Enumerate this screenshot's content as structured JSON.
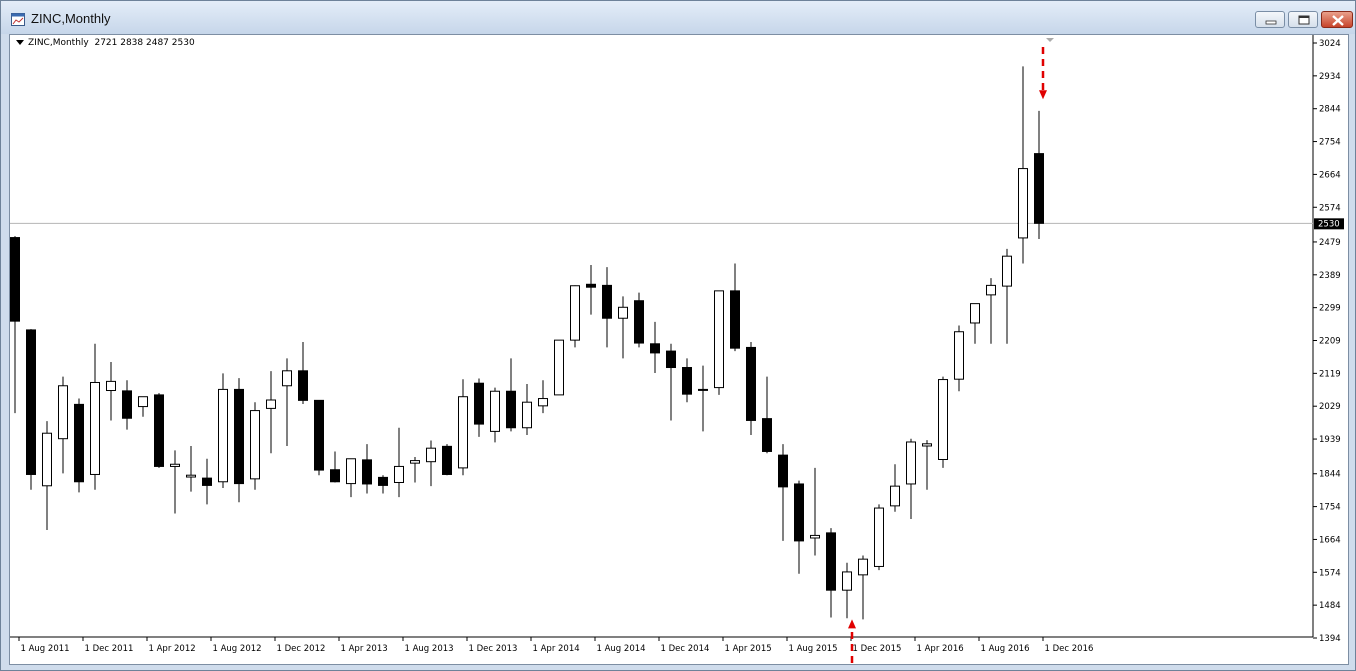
{
  "window": {
    "title": "ZINC,Monthly"
  },
  "chart_header": {
    "symbol": "ZINC,Monthly",
    "ohlc": "2721 2838 2487 2530"
  },
  "icons": {
    "app": "chart-window-icon",
    "minimize": "minimize-icon",
    "restore": "restore-icon",
    "close": "close-icon",
    "header_menu": "triangle-down-icon"
  },
  "colors": {
    "bull_fill": "#ffffff",
    "bear_fill": "#000000",
    "wick": "#000000",
    "price_line": "#b4b4b4",
    "arrow": "#e00000",
    "current_price_bg": "#000000"
  },
  "chart_data": {
    "type": "candlestick",
    "title": "ZINC,Monthly",
    "price_axis_ticks": [
      3024,
      2934,
      2844,
      2754,
      2664,
      2574,
      2479,
      2389,
      2299,
      2209,
      2119,
      2029,
      1939,
      1844,
      1754,
      1664,
      1574,
      1484,
      1394
    ],
    "time_axis_labels": [
      "1 Aug 2011",
      "1 Dec 2011",
      "1 Apr 2012",
      "1 Aug 2012",
      "1 Dec 2012",
      "1 Apr 2013",
      "1 Aug 2013",
      "1 Dec 2013",
      "1 Apr 2014",
      "1 Aug 2014",
      "1 Dec 2014",
      "1 Apr 2015",
      "1 Aug 2015",
      "1 Dec 2015",
      "1 Apr 2016",
      "1 Aug 2016",
      "1 Dec 2016"
    ],
    "current_price": "2530",
    "ylim": [
      1394,
      3024
    ],
    "annotations": [
      {
        "type": "arrow-down",
        "at": "1 Dec 2016",
        "value": 2870
      },
      {
        "type": "arrow-up",
        "at": "1 Dec 2015",
        "value": 1445
      }
    ],
    "candles": [
      {
        "d": "Jul 2011",
        "o": 2491,
        "h": 2495,
        "l": 2010,
        "c": 2262
      },
      {
        "d": "Aug 2011",
        "o": 2238,
        "h": 2240,
        "l": 1800,
        "c": 1842
      },
      {
        "d": "Sep 2011",
        "o": 1811,
        "h": 1988,
        "l": 1690,
        "c": 1955
      },
      {
        "d": "Oct 2011",
        "o": 1940,
        "h": 2110,
        "l": 1845,
        "c": 2085
      },
      {
        "d": "Nov 2011",
        "o": 2034,
        "h": 2050,
        "l": 1793,
        "c": 1822
      },
      {
        "d": "Dec 2011",
        "o": 1842,
        "h": 2200,
        "l": 1800,
        "c": 2094
      },
      {
        "d": "Jan 2012",
        "o": 2072,
        "h": 2150,
        "l": 1990,
        "c": 2097
      },
      {
        "d": "Feb 2012",
        "o": 2071,
        "h": 2100,
        "l": 1965,
        "c": 1996
      },
      {
        "d": "Mar 2012",
        "o": 2028,
        "h": 2055,
        "l": 2000,
        "c": 2055
      },
      {
        "d": "Apr 2012",
        "o": 2060,
        "h": 2065,
        "l": 1860,
        "c": 1864
      },
      {
        "d": "May 2012",
        "o": 1864,
        "h": 1908,
        "l": 1735,
        "c": 1870
      },
      {
        "d": "Jun 2012",
        "o": 1835,
        "h": 1920,
        "l": 1795,
        "c": 1840
      },
      {
        "d": "Jul 2012",
        "o": 1832,
        "h": 1885,
        "l": 1760,
        "c": 1812
      },
      {
        "d": "Aug 2012",
        "o": 1822,
        "h": 2119,
        "l": 1805,
        "c": 2075
      },
      {
        "d": "Sep 2012",
        "o": 2075,
        "h": 2106,
        "l": 1766,
        "c": 1817
      },
      {
        "d": "Oct 2012",
        "o": 1830,
        "h": 2040,
        "l": 1800,
        "c": 2017
      },
      {
        "d": "Nov 2012",
        "o": 2023,
        "h": 2125,
        "l": 1900,
        "c": 2046
      },
      {
        "d": "Dec 2012",
        "o": 2085,
        "h": 2160,
        "l": 1920,
        "c": 2126
      },
      {
        "d": "Jan 2013",
        "o": 2126,
        "h": 2205,
        "l": 2035,
        "c": 2045
      },
      {
        "d": "Feb 2013",
        "o": 2045,
        "h": 2045,
        "l": 1840,
        "c": 1854
      },
      {
        "d": "Mar 2013",
        "o": 1855,
        "h": 1905,
        "l": 1820,
        "c": 1822
      },
      {
        "d": "Apr 2013",
        "o": 1817,
        "h": 1880,
        "l": 1780,
        "c": 1885
      },
      {
        "d": "May 2013",
        "o": 1882,
        "h": 1925,
        "l": 1790,
        "c": 1816
      },
      {
        "d": "Jun 2013",
        "o": 1834,
        "h": 1840,
        "l": 1790,
        "c": 1812
      },
      {
        "d": "Jul 2013",
        "o": 1820,
        "h": 1970,
        "l": 1780,
        "c": 1864
      },
      {
        "d": "Aug 2013",
        "o": 1873,
        "h": 1890,
        "l": 1820,
        "c": 1880
      },
      {
        "d": "Sep 2013",
        "o": 1877,
        "h": 1935,
        "l": 1810,
        "c": 1914
      },
      {
        "d": "Oct 2013",
        "o": 1919,
        "h": 1925,
        "l": 1840,
        "c": 1842
      },
      {
        "d": "Nov 2013",
        "o": 1860,
        "h": 2103,
        "l": 1840,
        "c": 2055
      },
      {
        "d": "Dec 2013",
        "o": 2092,
        "h": 2105,
        "l": 1945,
        "c": 1980
      },
      {
        "d": "Jan 2014",
        "o": 1960,
        "h": 2080,
        "l": 1930,
        "c": 2070
      },
      {
        "d": "Feb 2014",
        "o": 2070,
        "h": 2160,
        "l": 1960,
        "c": 1970
      },
      {
        "d": "Mar 2014",
        "o": 1970,
        "h": 2090,
        "l": 1950,
        "c": 2040
      },
      {
        "d": "Apr 2014",
        "o": 2030,
        "h": 2100,
        "l": 2010,
        "c": 2050
      },
      {
        "d": "May 2014",
        "o": 2060,
        "h": 2210,
        "l": 2060,
        "c": 2210
      },
      {
        "d": "Jun 2014",
        "o": 2210,
        "h": 2360,
        "l": 2190,
        "c": 2359
      },
      {
        "d": "Jul 2014",
        "o": 2363,
        "h": 2416,
        "l": 2280,
        "c": 2355
      },
      {
        "d": "Aug 2014",
        "o": 2360,
        "h": 2410,
        "l": 2190,
        "c": 2270
      },
      {
        "d": "Sep 2014",
        "o": 2270,
        "h": 2330,
        "l": 2160,
        "c": 2300
      },
      {
        "d": "Oct 2014",
        "o": 2318,
        "h": 2340,
        "l": 2190,
        "c": 2202
      },
      {
        "d": "Nov 2014",
        "o": 2200,
        "h": 2260,
        "l": 2120,
        "c": 2175
      },
      {
        "d": "Dec 2014",
        "o": 2180,
        "h": 2200,
        "l": 1990,
        "c": 2135
      },
      {
        "d": "Jan 2015",
        "o": 2135,
        "h": 2160,
        "l": 2040,
        "c": 2062
      },
      {
        "d": "Feb 2015",
        "o": 2075,
        "h": 2140,
        "l": 1960,
        "c": 2075
      },
      {
        "d": "Mar 2015",
        "o": 2080,
        "h": 2345,
        "l": 2060,
        "c": 2345
      },
      {
        "d": "Apr 2015",
        "o": 2345,
        "h": 2420,
        "l": 2180,
        "c": 2188
      },
      {
        "d": "May 2015",
        "o": 2190,
        "h": 2205,
        "l": 1950,
        "c": 1990
      },
      {
        "d": "Jun 2015",
        "o": 1995,
        "h": 2110,
        "l": 1900,
        "c": 1905
      },
      {
        "d": "Jul 2015",
        "o": 1895,
        "h": 1925,
        "l": 1660,
        "c": 1808
      },
      {
        "d": "Aug 2015",
        "o": 1816,
        "h": 1825,
        "l": 1570,
        "c": 1660
      },
      {
        "d": "Sep 2015",
        "o": 1668,
        "h": 1860,
        "l": 1620,
        "c": 1675
      },
      {
        "d": "Oct 2015",
        "o": 1682,
        "h": 1695,
        "l": 1450,
        "c": 1525
      },
      {
        "d": "Nov 2015",
        "o": 1525,
        "h": 1600,
        "l": 1448,
        "c": 1575
      },
      {
        "d": "Dec 2015",
        "o": 1567,
        "h": 1620,
        "l": 1445,
        "c": 1610
      },
      {
        "d": "Jan 2016",
        "o": 1590,
        "h": 1760,
        "l": 1580,
        "c": 1750
      },
      {
        "d": "Feb 2016",
        "o": 1756,
        "h": 1870,
        "l": 1740,
        "c": 1810
      },
      {
        "d": "Mar 2016",
        "o": 1816,
        "h": 1940,
        "l": 1720,
        "c": 1931
      },
      {
        "d": "Apr 2016",
        "o": 1920,
        "h": 1936,
        "l": 1800,
        "c": 1926
      },
      {
        "d": "May 2016",
        "o": 1883,
        "h": 2110,
        "l": 1860,
        "c": 2102
      },
      {
        "d": "Jun 2016",
        "o": 2103,
        "h": 2250,
        "l": 2070,
        "c": 2233
      },
      {
        "d": "Jul 2016",
        "o": 2257,
        "h": 2290,
        "l": 2200,
        "c": 2310
      },
      {
        "d": "Aug 2016",
        "o": 2334,
        "h": 2380,
        "l": 2200,
        "c": 2360
      },
      {
        "d": "Sep 2016",
        "o": 2358,
        "h": 2460,
        "l": 2200,
        "c": 2440
      },
      {
        "d": "Oct 2016",
        "o": 2490,
        "h": 2960,
        "l": 2420,
        "c": 2680
      },
      {
        "d": "Nov 2016",
        "o": 2721,
        "h": 2838,
        "l": 2487,
        "c": 2530
      }
    ]
  }
}
